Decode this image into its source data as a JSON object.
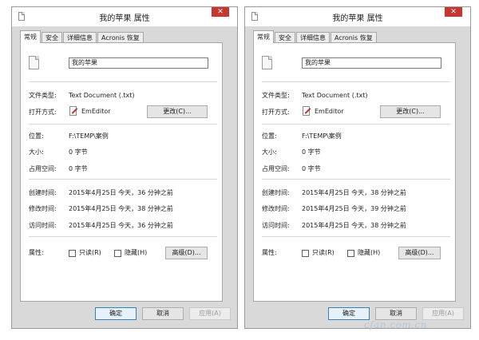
{
  "windows": [
    {
      "title": "我的苹果 属性",
      "close_glyph": "✕",
      "tabs": [
        {
          "label": "常规",
          "active": true
        },
        {
          "label": "安全",
          "active": false
        },
        {
          "label": "详细信息",
          "active": false
        },
        {
          "label": "Acronis 恢复",
          "active": false
        }
      ],
      "file_name": "我的苹果",
      "file_type_label": "文件类型:",
      "file_type_value": "Text Document (.txt)",
      "opens_with_label": "打开方式:",
      "opens_with_app": "EmEditor",
      "change_button": "更改(C)...",
      "location_label": "位置:",
      "location_value": "F:\\TEMP\\案例",
      "size_label": "大小:",
      "size_value": "0 字节",
      "size_on_disk_label": "占用空间:",
      "size_on_disk_value": "0 字节",
      "created_label": "创建时间:",
      "created_value": "2015年4月25日 今天，36 分钟之前",
      "modified_label": "修改时间:",
      "modified_value": "2015年4月25日 今天，38 分钟之前",
      "accessed_label": "访问时间:",
      "accessed_value": "2015年4月25日 今天，36 分钟之前",
      "attributes_label": "属性:",
      "readonly_label": "只读(R)",
      "hidden_label": "隐藏(H)",
      "advanced_button": "高级(D)...",
      "ok_button": "确定",
      "cancel_button": "取消",
      "apply_button": "应用(A)"
    },
    {
      "title": "我的苹果 属性",
      "close_glyph": "✕",
      "tabs": [
        {
          "label": "常规",
          "active": true
        },
        {
          "label": "安全",
          "active": false
        },
        {
          "label": "详细信息",
          "active": false
        },
        {
          "label": "Acronis 恢复",
          "active": false
        }
      ],
      "file_name": "我的苹果",
      "file_type_label": "文件类型:",
      "file_type_value": "Text Document (.txt)",
      "opens_with_label": "打开方式:",
      "opens_with_app": "EmEditor",
      "change_button": "更改(C)...",
      "location_label": "位置:",
      "location_value": "F:\\TEMP\\案例",
      "size_label": "大小:",
      "size_value": "0 字节",
      "size_on_disk_label": "占用空间:",
      "size_on_disk_value": "0 字节",
      "created_label": "创建时间:",
      "created_value": "2015年4月25日 今天，38 分钟之前",
      "modified_label": "修改时间:",
      "modified_value": "2015年4月25日 今天，39 分钟之前",
      "accessed_label": "访问时间:",
      "accessed_value": "2015年4月25日 今天，38 分钟之前",
      "attributes_label": "属性:",
      "readonly_label": "只读(R)",
      "hidden_label": "隐藏(H)",
      "advanced_button": "高级(D)...",
      "ok_button": "确定",
      "cancel_button": "取消",
      "apply_button": "应用(A)"
    }
  ],
  "watermark": "cfan.com.cn",
  "colors": {
    "close_red": "#c7362f",
    "ok_border": "#3c7fb1",
    "window_bg": "#d9d9d9"
  }
}
